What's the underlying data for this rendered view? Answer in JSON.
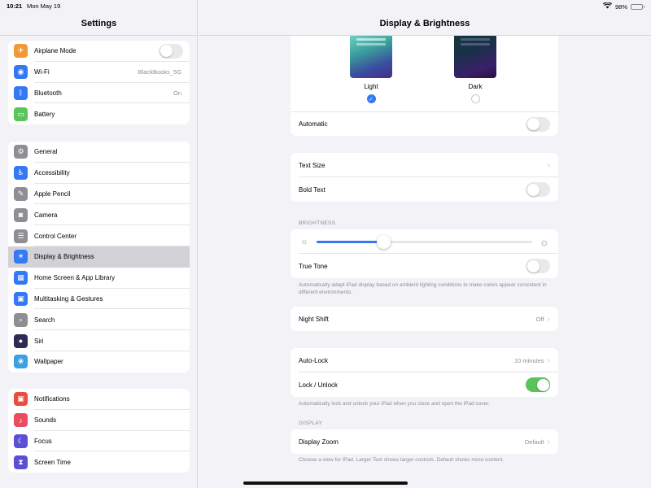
{
  "status": {
    "time": "10:21",
    "date": "Mon May 19",
    "battery": "98%"
  },
  "sidebar": {
    "title": "Settings",
    "group1": [
      {
        "label": "Airplane Mode",
        "icon": "airplane-icon",
        "color": "#f09a37",
        "glyph": "✈",
        "control": "toggle"
      },
      {
        "label": "Wi-Fi",
        "icon": "wifi-icon",
        "color": "#3478f6",
        "glyph": "◉",
        "value": "BlackBooks_5G"
      },
      {
        "label": "Bluetooth",
        "icon": "bluetooth-icon",
        "color": "#3478f6",
        "glyph": "ᛒ",
        "value": "On"
      },
      {
        "label": "Battery",
        "icon": "battery-icon",
        "color": "#5ac35a",
        "glyph": "▭"
      }
    ],
    "group2": [
      {
        "label": "General",
        "icon": "gear-icon",
        "color": "#8e8e93",
        "glyph": "⚙"
      },
      {
        "label": "Accessibility",
        "icon": "accessibility-icon",
        "color": "#3478f6",
        "glyph": "♿"
      },
      {
        "label": "Apple Pencil",
        "icon": "pencil-icon",
        "color": "#8e8e93",
        "glyph": "✎"
      },
      {
        "label": "Camera",
        "icon": "camera-icon",
        "color": "#8e8e93",
        "glyph": "◙"
      },
      {
        "label": "Control Center",
        "icon": "control-center-icon",
        "color": "#8e8e93",
        "glyph": "☰"
      },
      {
        "label": "Display & Brightness",
        "icon": "brightness-icon",
        "color": "#3478f6",
        "glyph": "☀",
        "selected": true
      },
      {
        "label": "Home Screen & App Library",
        "icon": "home-screen-icon",
        "color": "#3478f6",
        "glyph": "▦"
      },
      {
        "label": "Multitasking & Gestures",
        "icon": "multitasking-icon",
        "color": "#3478f6",
        "glyph": "▣"
      },
      {
        "label": "Search",
        "icon": "search-icon",
        "color": "#8e8e93",
        "glyph": "⌕"
      },
      {
        "label": "Siri",
        "icon": "siri-icon",
        "color": "#2c2c54",
        "glyph": "●"
      },
      {
        "label": "Wallpaper",
        "icon": "wallpaper-icon",
        "color": "#3aa0e0",
        "glyph": "❀"
      }
    ],
    "group3": [
      {
        "label": "Notifications",
        "icon": "notifications-icon",
        "color": "#ea4d3d",
        "glyph": "▣"
      },
      {
        "label": "Sounds",
        "icon": "sounds-icon",
        "color": "#ea4d5e",
        "glyph": "♪"
      },
      {
        "label": "Focus",
        "icon": "focus-icon",
        "color": "#5b4fd6",
        "glyph": "☾"
      },
      {
        "label": "Screen Time",
        "icon": "screen-time-icon",
        "color": "#5b4fd6",
        "glyph": "⧗"
      }
    ]
  },
  "detail": {
    "title": "Display & Brightness",
    "appearance": {
      "light_label": "Light",
      "dark_label": "Dark",
      "selected": "light"
    },
    "automatic_label": "Automatic",
    "text_size_label": "Text Size",
    "bold_text_label": "Bold Text",
    "brightness_header": "BRIGHTNESS",
    "brightness_level": 0.31,
    "true_tone_label": "True Tone",
    "true_tone_caption": "Automatically adapt iPad display based on ambient lighting conditions to make colors appear consistent in different environments.",
    "night_shift_label": "Night Shift",
    "night_shift_value": "Off",
    "auto_lock_label": "Auto-Lock",
    "auto_lock_value": "10 minutes",
    "lock_unlock_label": "Lock / Unlock",
    "lock_unlock_caption": "Automatically lock and unlock your iPad when you close and open the iPad cover.",
    "display_header": "DISPLAY",
    "display_zoom_label": "Display Zoom",
    "display_zoom_value": "Default",
    "display_zoom_caption": "Choose a view for iPad. Larger Text shows larger controls. Default shows more content."
  }
}
